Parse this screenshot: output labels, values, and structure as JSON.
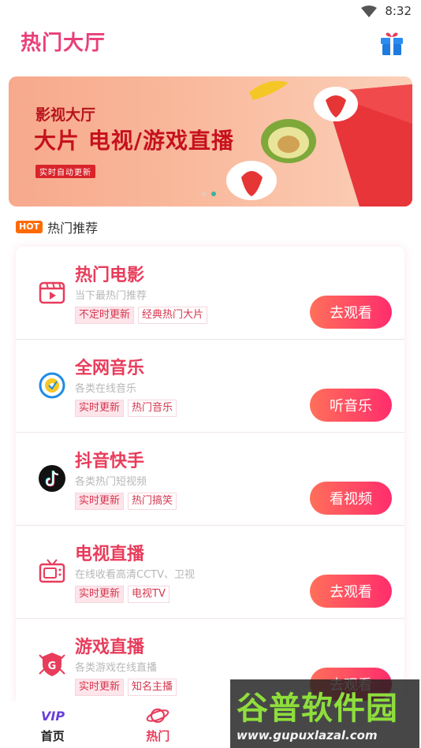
{
  "status": {
    "time": "8:32"
  },
  "header": {
    "title": "热门大厅"
  },
  "banner": {
    "subtitle": "影视大厅",
    "title": "大片 电视/游戏直播",
    "tag": "实时自动更新"
  },
  "section": {
    "badge": "HOT",
    "label": "热门推荐"
  },
  "items": [
    {
      "title": "热门电影",
      "desc": "当下最热门推荐",
      "tags": [
        "不定时更新",
        "经典热门大片"
      ],
      "button": "去观看",
      "icon": "film-icon"
    },
    {
      "title": "全网音乐",
      "desc": "各类在线音乐",
      "tags": [
        "实时更新",
        "热门音乐"
      ],
      "button": "听音乐",
      "icon": "music-disc-icon"
    },
    {
      "title": "抖音快手",
      "desc": "各类热门短视频",
      "tags": [
        "实时更新",
        "热门搞笑"
      ],
      "button": "看视频",
      "icon": "tiktok-icon"
    },
    {
      "title": "电视直播",
      "desc": "在线收看高清CCTV、卫视",
      "tags": [
        "实时更新",
        "电视TV"
      ],
      "button": "去观看",
      "icon": "tv-icon"
    },
    {
      "title": "游戏直播",
      "desc": "各类游戏在线直播",
      "tags": [
        "实时更新",
        "知名主播"
      ],
      "button": "去观看",
      "icon": "game-shield-icon"
    }
  ],
  "nav": [
    {
      "label": "首页",
      "icon": "vip-icon",
      "active": false
    },
    {
      "label": "热门",
      "icon": "planet-icon",
      "active": true
    },
    {
      "label": "",
      "icon": "",
      "active": false
    },
    {
      "label": "",
      "icon": "",
      "active": false
    }
  ],
  "watermark": {
    "title": "谷普软件园",
    "url": "www.gupuxlazal.com"
  },
  "colors": {
    "accent": "#e83c5b",
    "button_start": "#ff6f5a",
    "button_end": "#ff2d6c",
    "hot_badge": "#ff6a00"
  }
}
